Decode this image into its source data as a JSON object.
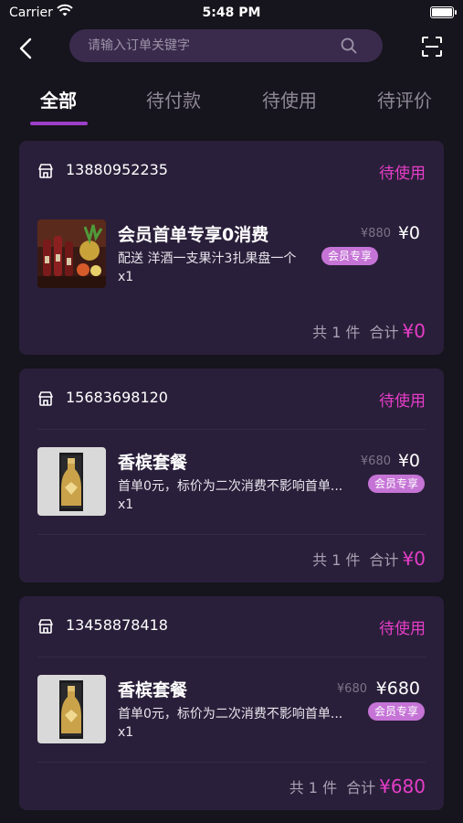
{
  "status_bar": {
    "carrier": "Carrier",
    "time": "5:48 PM"
  },
  "search": {
    "placeholder": "请输入订单关键字"
  },
  "tabs": [
    {
      "label": "全部"
    },
    {
      "label": "待付款"
    },
    {
      "label": "待使用"
    },
    {
      "label": "待评价"
    }
  ],
  "orders": [
    {
      "phone": "13880952235",
      "status": "待使用",
      "product_name": "会员首单专享0消费",
      "original_price": "¥880",
      "price": "¥0",
      "description": "配送 洋酒一支果汁3扎果盘一个",
      "tag": "会员专享",
      "quantity": "x1",
      "count_label": "共 1 件",
      "total_label": "合计",
      "total": "¥0"
    },
    {
      "phone": "15683698120",
      "status": "待使用",
      "product_name": "香槟套餐",
      "original_price": "¥680",
      "price": "¥0",
      "description": "首单0元，标价为二次消费不影响首单...",
      "tag": "会员专享",
      "quantity": "x1",
      "count_label": "共 1 件",
      "total_label": "合计",
      "total": "¥0"
    },
    {
      "phone": "13458878418",
      "status": "待使用",
      "product_name": "香槟套餐",
      "original_price": "¥680",
      "price": "¥680",
      "description": "首单0元，标价为二次消费不影响首单...",
      "tag": "会员专享",
      "quantity": "x1",
      "count_label": "共 1 件",
      "total_label": "合计",
      "total": "¥680"
    }
  ],
  "colors": {
    "background": "#16141c",
    "card": "#2a1f3a",
    "accent": "#e63dc8",
    "tab_indicator": "#9b3fc8",
    "member_tag": "#c574d6"
  },
  "icons": [
    "back-arrow-icon",
    "search-icon",
    "scan-icon",
    "store-icon",
    "wifi-icon",
    "battery-icon"
  ]
}
